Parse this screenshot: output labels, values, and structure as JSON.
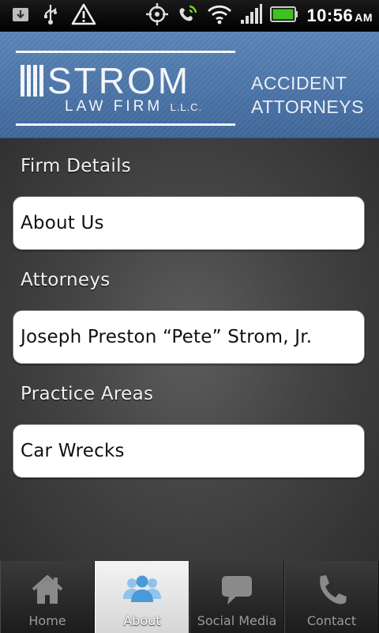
{
  "status_bar": {
    "time": "10:56",
    "ampm": "AM",
    "icons": [
      "download-icon",
      "usb-icon",
      "warning-icon",
      "gps-icon",
      "phone-sync-icon",
      "wifi-icon",
      "signal-icon",
      "battery-icon"
    ]
  },
  "header": {
    "logo_name": "STROM",
    "logo_firm": "LAW FIRM",
    "logo_llc": "L.L.C.",
    "tagline_line1": "ACCIDENT",
    "tagline_line2": "ATTORNEYS"
  },
  "sections": [
    {
      "title": "Firm Details",
      "item": "About Us"
    },
    {
      "title": "Attorneys",
      "item": "Joseph Preston “Pete” Strom, Jr."
    },
    {
      "title": "Practice Areas",
      "item": "Car Wrecks"
    }
  ],
  "tabs": [
    {
      "label": "Home",
      "icon": "home-icon",
      "active": false
    },
    {
      "label": "About",
      "icon": "people-icon",
      "active": true
    },
    {
      "label": "Social Media",
      "icon": "speech-bubble-icon",
      "active": false
    },
    {
      "label": "Contact",
      "icon": "phone-icon",
      "active": false
    }
  ],
  "colors": {
    "header_blue": "#4a73a6",
    "card_bg": "#ffffff",
    "active_tab_icon": "#4a9ad8"
  }
}
